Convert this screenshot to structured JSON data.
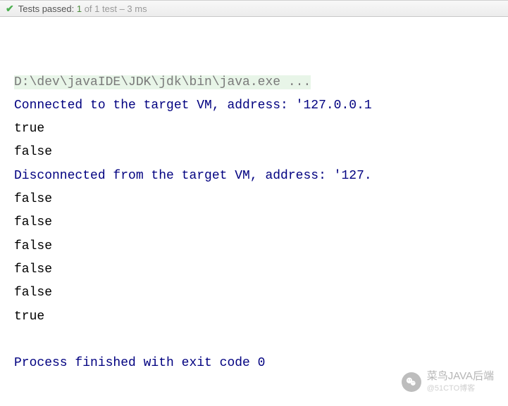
{
  "statusBar": {
    "label": "Tests passed:",
    "passedCount": "1",
    "restText": " of 1 test – 3 ms"
  },
  "console": {
    "commandLine": "D:\\dev\\javaIDE\\JDK\\jdk\\bin\\java.exe ...",
    "lines": [
      {
        "text": "Connected to the target VM, address: '127.0.0.1",
        "style": "blue"
      },
      {
        "text": "true",
        "style": "black"
      },
      {
        "text": "false",
        "style": "black"
      },
      {
        "text": "Disconnected from the target VM, address: '127.",
        "style": "blue"
      },
      {
        "text": "false",
        "style": "black"
      },
      {
        "text": "false",
        "style": "black"
      },
      {
        "text": "false",
        "style": "black"
      },
      {
        "text": "false",
        "style": "black"
      },
      {
        "text": "false",
        "style": "black"
      },
      {
        "text": "true",
        "style": "black"
      },
      {
        "text": "",
        "style": "black"
      },
      {
        "text": "Process finished with exit code 0",
        "style": "blue"
      }
    ]
  },
  "watermark": {
    "main": "菜鸟JAVA后端",
    "sub": "@51CTO博客"
  }
}
